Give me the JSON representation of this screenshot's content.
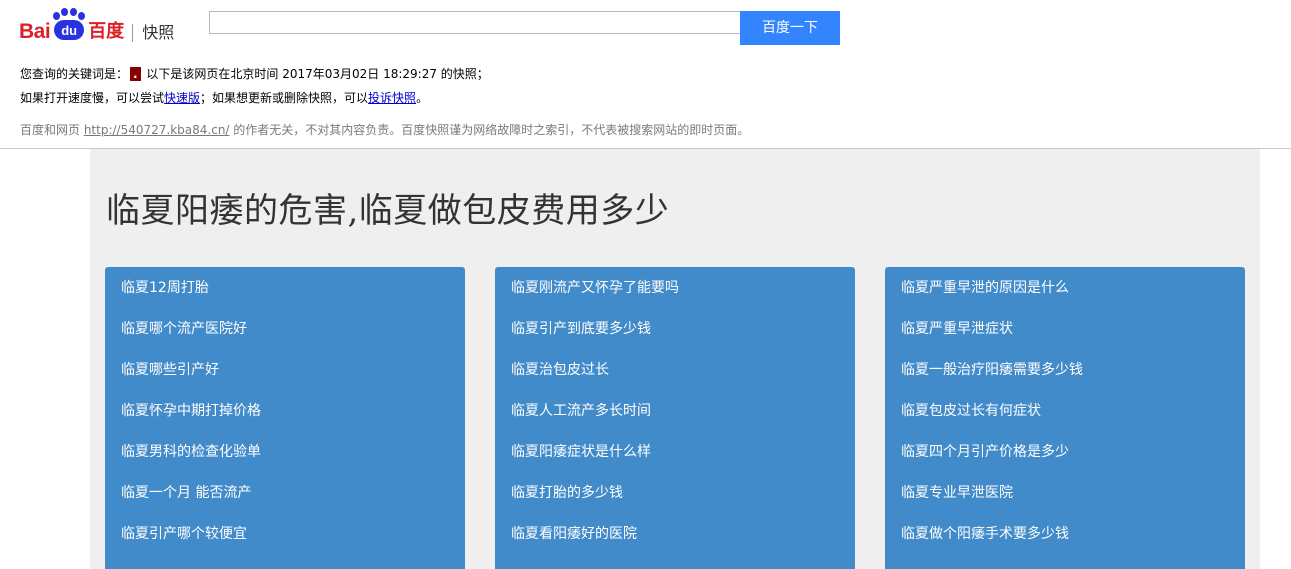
{
  "header": {
    "logo": {
      "bai": "Bai",
      "du": "du",
      "cn": "百度",
      "snapshot": "快照"
    },
    "search": {
      "value": "",
      "button_label": "百度一下"
    }
  },
  "info": {
    "line1": {
      "prefix": "您查询的关键词是：",
      "keyword": ".",
      "suffix": " 以下是该网页在北京时间 2017年03月02日 18:29:27 的快照；"
    },
    "line2": {
      "part1": "如果打开速度慢，可以尝试",
      "fast_link": "快速版",
      "part2": "；如果想更新或删除快照，可以",
      "complain_link": "投诉快照",
      "part3": "。"
    },
    "disclaimer": {
      "prefix": "百度和网页 ",
      "url": "http://540727.kba84.cn/",
      "suffix": " 的作者无关，不对其内容负责。百度快照谨为网络故障时之索引，不代表被搜索网站的即时页面。"
    }
  },
  "page": {
    "title": "临夏阳痿的危害,临夏做包皮费用多少",
    "columns": [
      {
        "items": [
          "临夏12周打胎",
          "临夏哪个流产医院好",
          "临夏哪些引产好",
          "临夏怀孕中期打掉价格",
          "临夏男科的检查化验单",
          "临夏一个月 能否流产",
          "临夏引产哪个较便宜"
        ]
      },
      {
        "items": [
          "临夏刚流产又怀孕了能要吗",
          "临夏引产到底要多少钱",
          "临夏治包皮过长",
          "临夏人工流产多长时间",
          "临夏阳痿症状是什么样",
          "临夏打胎的多少钱",
          "临夏看阳痿好的医院"
        ]
      },
      {
        "items": [
          "临夏严重早泄的原因是什么",
          "临夏严重早泄症状",
          "临夏一般治疗阳痿需要多少钱",
          "临夏包皮过长有何症状",
          "临夏四个月引产价格是多少",
          "临夏专业早泄医院",
          "临夏做个阳痿手术要多少钱"
        ]
      }
    ]
  }
}
